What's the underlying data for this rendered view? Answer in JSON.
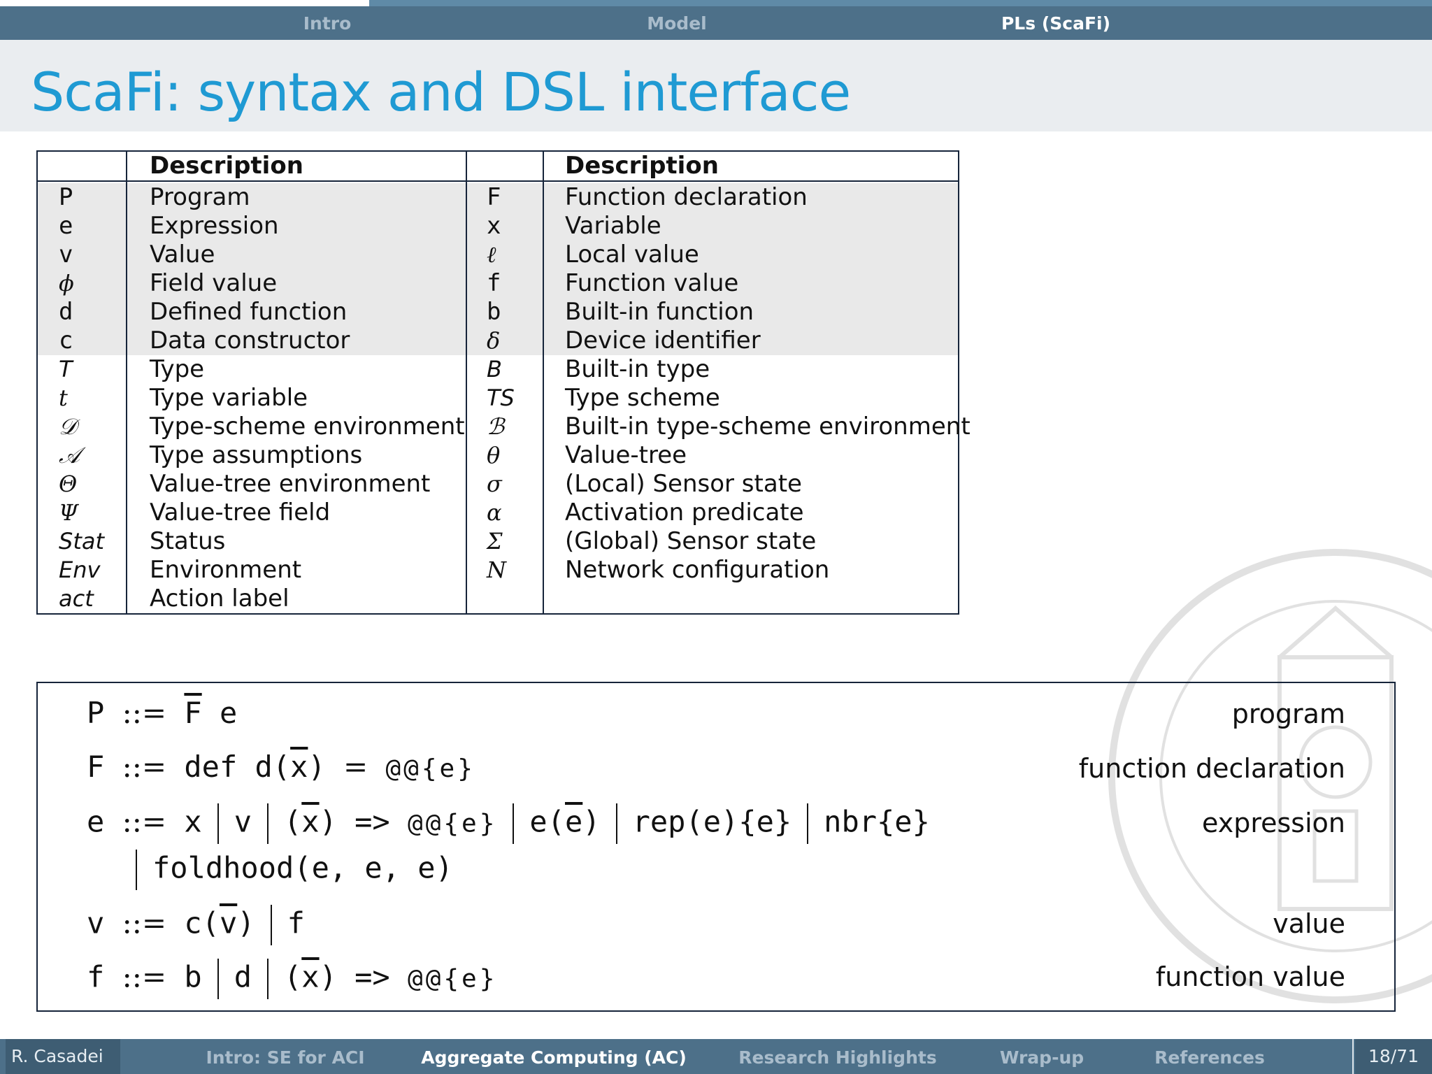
{
  "nav": {
    "sections": [
      "Intro",
      "Model",
      "PLs (ScaFi)"
    ],
    "active": "PLs (ScaFi)",
    "progress_fraction": 0.26
  },
  "slide": {
    "title": "ScaFi: syntax and DSL interface"
  },
  "symbol_table": {
    "header_left": "Description",
    "header_right": "Description",
    "left_rows": [
      {
        "symbol": "P",
        "description": "Program"
      },
      {
        "symbol": "e",
        "description": "Expression"
      },
      {
        "symbol": "v",
        "description": "Value"
      },
      {
        "symbol": "ϕ",
        "description": "Field value"
      },
      {
        "symbol": "d",
        "description": "Defined function"
      },
      {
        "symbol": "c",
        "description": "Data constructor"
      },
      {
        "symbol": "T",
        "description": "Type"
      },
      {
        "symbol": "t",
        "description": "Type variable"
      },
      {
        "symbol": "𝒟",
        "description": "Type-scheme environment"
      },
      {
        "symbol": "𝒜",
        "description": "Type assumptions"
      },
      {
        "symbol": "Θ",
        "description": "Value-tree environment"
      },
      {
        "symbol": "Ψ",
        "description": "Value-tree field"
      },
      {
        "symbol": "Stat",
        "description": "Status"
      },
      {
        "symbol": "Env",
        "description": "Environment"
      },
      {
        "symbol": "act",
        "description": "Action label"
      }
    ],
    "right_rows": [
      {
        "symbol": "F",
        "description": "Function declaration"
      },
      {
        "symbol": "x",
        "description": "Variable"
      },
      {
        "symbol": "ℓ",
        "description": "Local value"
      },
      {
        "symbol": "f",
        "description": "Function value"
      },
      {
        "symbol": "b",
        "description": "Built-in function"
      },
      {
        "symbol": "δ",
        "description": "Device identifier"
      },
      {
        "symbol": "B",
        "description": "Built-in type"
      },
      {
        "symbol": "TS",
        "description": "Type scheme"
      },
      {
        "symbol": "ℬ",
        "description": "Built-in type-scheme environment"
      },
      {
        "symbol": "θ",
        "description": "Value-tree"
      },
      {
        "symbol": "σ",
        "description": "(Local) Sensor state"
      },
      {
        "symbol": "α",
        "description": "Activation predicate"
      },
      {
        "symbol": "Σ",
        "description": "(Global) Sensor state"
      },
      {
        "symbol": "N",
        "description": "Network configuration"
      }
    ]
  },
  "grammar": {
    "rules": [
      {
        "lhs": "P",
        "rhs": "F̅ e",
        "label": "program"
      },
      {
        "lhs": "F",
        "rhs": "def d(x̅) = @@{e}",
        "label": "function declaration"
      },
      {
        "lhs": "e",
        "rhs": "x | v | (x̅) => @@{e} | e(e̅) | rep(e){e} | nbr{e}",
        "label": "expression"
      },
      {
        "lhs": "",
        "rhs": "| foldhood(e, e, e)",
        "label": ""
      },
      {
        "lhs": "v",
        "rhs": "c(v̅) | f",
        "label": "value"
      },
      {
        "lhs": "f",
        "rhs": "b | d | (x̅) => @@{e}",
        "label": "function value"
      }
    ],
    "def_symbol": "::="
  },
  "footer": {
    "author": "R. Casadei",
    "sections": [
      "Intro: SE for ACI",
      "Aggregate Computing (AC)",
      "Research Highlights",
      "Wrap-up",
      "References"
    ],
    "active": "Aggregate Computing (AC)",
    "page": "18/71"
  }
}
